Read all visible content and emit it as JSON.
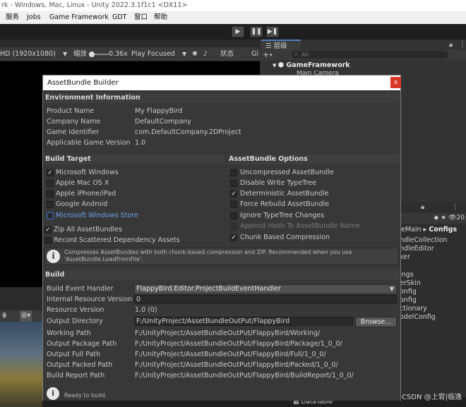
{
  "window": {
    "title": "rk - Windows, Mac, Linux - Unity 2022.3.1f1c1 <DX11>"
  },
  "menubar": {
    "items": [
      "服务",
      "Jobs",
      "Game Framework",
      "GDT",
      "窗口",
      "帮助"
    ]
  },
  "game_toolbar": {
    "resolution": "HD (1920x1080)",
    "scale_label": "缩放",
    "scale_value": "0.36x",
    "play_mode": "Play Focused",
    "stats_label": "状态",
    "gizmos_label": "Gi"
  },
  "hierarchy": {
    "tab_label": "层级",
    "add_label": "+",
    "search_placeholder": "All",
    "root": "GameFramework",
    "child": "Main Camera"
  },
  "project": {
    "count": "20",
    "path_prefix": "eMain",
    "path_current": "Configs",
    "items": [
      "ndleCollection",
      "ndleEditor",
      "ker",
      "ings",
      "erSkin",
      "onfig",
      "onfig",
      "ctionary",
      "odelConfig"
    ]
  },
  "bottom": {
    "datatable_tab": "DataTable",
    "watermark": "CSDN @上官|临逸"
  },
  "dialog": {
    "title": "AssetBundle Builder",
    "close_label": "x",
    "environment": {
      "header": "Environment Information",
      "rows": [
        {
          "label": "Product Name",
          "value": "My FlappyBird"
        },
        {
          "label": "Company Name",
          "value": "DefaultCompany"
        },
        {
          "label": "Game Identifier",
          "value": "com.DefaultCompany.2DProject"
        },
        {
          "label": "Applicable Game Version",
          "value": "1.0"
        }
      ]
    },
    "build_target": {
      "header": "Build Target",
      "items": [
        {
          "label": "Microsoft Windows",
          "mark": "✓"
        },
        {
          "label": "Apple Mac OS X",
          "mark": ""
        },
        {
          "label": "Apple iPhone/iPad",
          "mark": ""
        },
        {
          "label": "Google Android",
          "mark": ""
        },
        {
          "label": "Microsoft Windows Store",
          "mark": ""
        }
      ]
    },
    "assetbundle_options": {
      "header": "AssetBundle Options",
      "items": [
        {
          "label": "Uncompressed AssetBundle",
          "mark": ""
        },
        {
          "label": "Disable Write TypeTree",
          "mark": ""
        },
        {
          "label": "Deterministic AssetBundle",
          "mark": "✓"
        },
        {
          "label": "Force Rebuild AssetBundle",
          "mark": ""
        },
        {
          "label": "Ignore TypeTree Changes",
          "mark": ""
        },
        {
          "label": "Append Hash To AssetBundle Name",
          "mark": ""
        },
        {
          "label": "Chunk Based Compression",
          "mark": "✓"
        }
      ]
    },
    "extra": {
      "zip_all": {
        "label": "Zip All AssetBundles",
        "mark": "✓"
      },
      "record_scattered": {
        "label": "Record Scattered Dependency Assets",
        "mark": ""
      }
    },
    "help": {
      "icon": "i",
      "text": "Compresses AssetBundles with both chunk-based compression and ZIP. Recommended when you use 'AssetBundle.LoadFromFile'."
    },
    "build": {
      "header": "Build",
      "event_handler_label": "Build Event Handler",
      "event_handler_value": "FlappyBird.Editor.ProjectBuildEventHandler",
      "internal_version_label": "Internal Resource Version",
      "internal_version_value": "0",
      "resource_version_label": "Resource Version",
      "resource_version_value": "1.0 (0)",
      "output_dir_label": "Output Directory",
      "output_dir_value": "F:/UnityProject/AssetBundleOutPut/FlappyBird",
      "browse_label": "Browse...",
      "paths": [
        {
          "label": "Working Path",
          "value": "F:/UnityProject/AssetBundleOutPut/FlappyBird/Working/"
        },
        {
          "label": "Output Package Path",
          "value": "F:/UnityProject/AssetBundleOutPut/FlappyBird/Package/1_0_0/"
        },
        {
          "label": "Output Full Path",
          "value": "F:/UnityProject/AssetBundleOutPut/FlappyBird/Full/1_0_0/"
        },
        {
          "label": "Output Packed Path",
          "value": "F:/UnityProject/AssetBundleOutPut/FlappyBird/Packed/1_0_0/"
        },
        {
          "label": "Build Report Path",
          "value": "F:/UnityProject/AssetBundleOutPut/FlappyBird/BuildReport/1_0_0/"
        }
      ]
    },
    "status": {
      "icon": "i",
      "text": "Ready to build."
    }
  }
}
